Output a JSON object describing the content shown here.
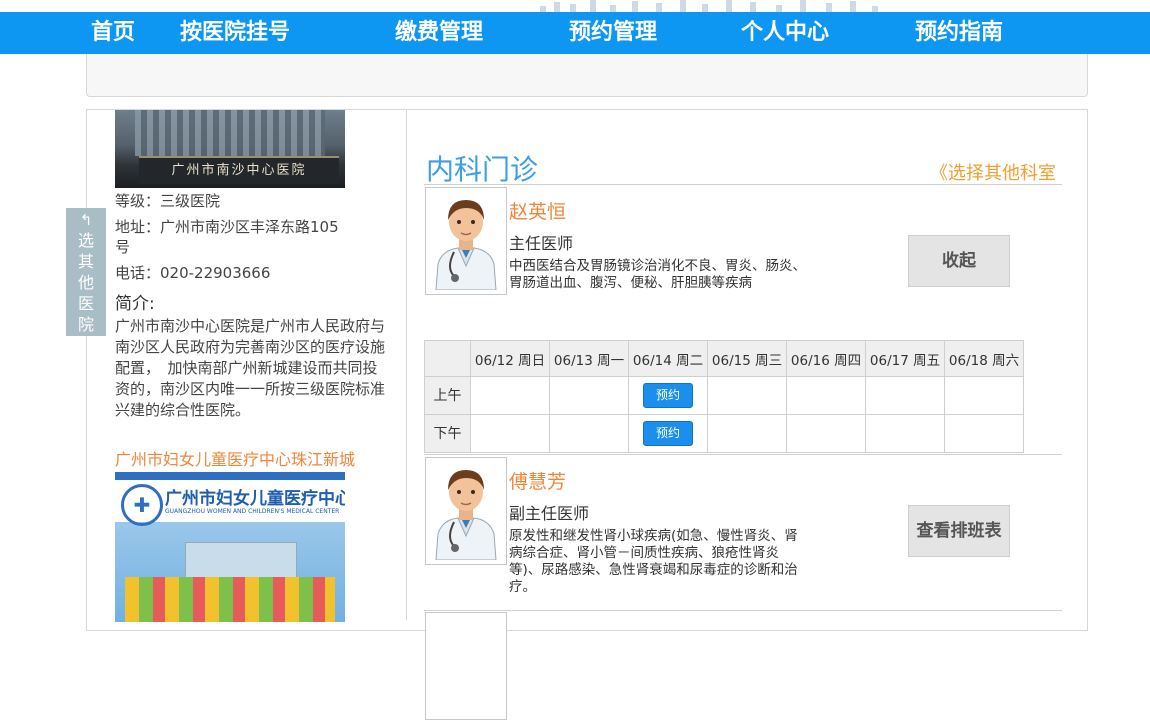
{
  "nav": {
    "items": [
      "首页",
      "按医院挂号",
      "缴费管理",
      "预约管理",
      "个人中心",
      "预约指南"
    ]
  },
  "hospital": {
    "photo_sign": "广州市南沙中心医院",
    "level": "等级：三级医院",
    "address_line1": "地址：广州市南沙区丰泽东路105",
    "address_line2": "号",
    "phone": "电话：020-22903666",
    "intro_title": "简介:",
    "intro": "广州市南沙中心医院是广州市人民政府与南沙区人民政府为完善南沙区的医疗设施配置，　加快南部广州新城建设而共同投资的，南沙区内唯一一所按三级医院标准兴建的综合性医院。"
  },
  "other_hospital": {
    "link": "广州市妇女儿童医疗中心珠江新城",
    "logo_name": "广州市妇女儿童医疗中心",
    "logo_english": "GUANGZHOU WOMEN AND CHILDREN'S MEDICAL CENTER"
  },
  "side_tab": {
    "arrow": "↰",
    "chars": [
      "选",
      "其",
      "他",
      "医",
      "院"
    ]
  },
  "department": {
    "title": "内科门诊",
    "other_link": "《选择其他科室"
  },
  "doctors": [
    {
      "name": "赵英恒",
      "title": "主任医师",
      "desc": "中西医结合及胃肠镜诊治消化不良、胃炎、肠炎、胃肠道出血、腹泻、便秘、肝胆胰等疾病",
      "button": "收起"
    },
    {
      "name": "傅慧芳",
      "title": "副主任医师",
      "desc": "原发性和继发性肾小球疾病(如急、慢性肾炎、肾病综合症、肾小管－间质性疾病、狼疮性肾炎等)、尿路感染、急性肾衰竭和尿毒症的诊断和治疗。",
      "button": "查看排班表"
    }
  ],
  "schedule": {
    "days": [
      "06/12 周日",
      "06/13 周一",
      "06/14 周二",
      "06/15 周三",
      "06/16 周四",
      "06/17 周五",
      "06/18 周六"
    ],
    "periods": [
      "上午",
      "下午"
    ],
    "book_label": "预约",
    "available": [
      [
        2
      ],
      [
        2
      ]
    ]
  }
}
